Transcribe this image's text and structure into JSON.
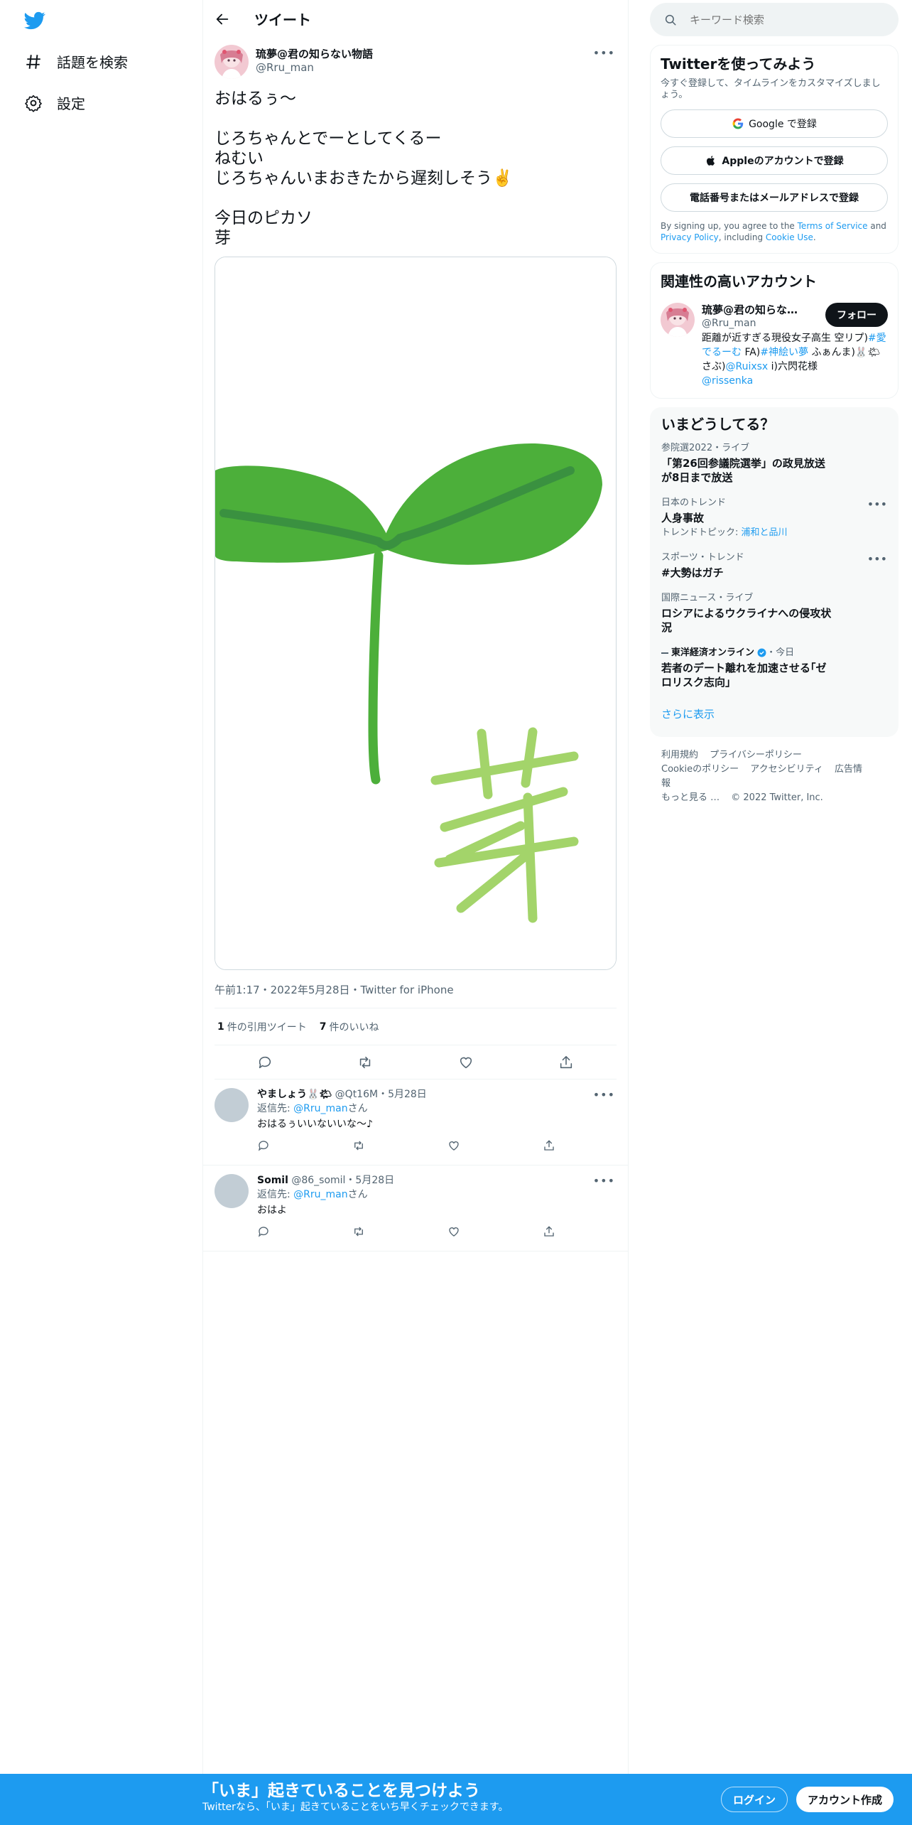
{
  "nav": {
    "explore_label": "話題を検索",
    "settings_label": "設定"
  },
  "header": {
    "title": "ツイート"
  },
  "tweet": {
    "display_name": "琉夢@君の知らない物語",
    "handle": "@Rru_man",
    "text": "おはるぅ〜\n\nじろちゃんとでーとしてくるー\nねむい\nじろちゃんいまおきたから遅刻しそう✌️\n\n今日のピカソ\n芽",
    "image_char": "芽",
    "meta": "午前1:17・2022年5月28日・Twitter for iPhone",
    "quote_count": "1",
    "quote_label": "件の引用ツイート",
    "like_count": "7",
    "like_label": "件のいいね"
  },
  "replies": [
    {
      "name": "やましょう🐰🌤",
      "handle_date": "@Qt16M・5月28日",
      "reply_prefix": "返信先: ",
      "reply_to": "@Rru_man",
      "reply_suffix": "さん",
      "text": "おはるぅいいないいな〜♪"
    },
    {
      "name": "Somil",
      "handle_date": "@86_somil・5月28日",
      "reply_prefix": "返信先: ",
      "reply_to": "@Rru_man",
      "reply_suffix": "さん",
      "text": "おはよ"
    }
  ],
  "search": {
    "placeholder": "キーワード検索"
  },
  "signup": {
    "title": "Twitterを使ってみよう",
    "subtitle": "今すぐ登録して、タイムラインをカスタマイズしましょう。",
    "google_label": "Google で登録",
    "apple_label": "Appleのアカウントで登録",
    "phone_label": "電話番号またはメールアドレスで登録",
    "legal_1": "By signing up, you agree to the ",
    "legal_tos": "Terms of Service",
    "legal_2": " and ",
    "legal_privacy": "Privacy Policy",
    "legal_3": ", including ",
    "legal_cookie": "Cookie Use",
    "legal_4": "."
  },
  "related": {
    "title": "関連性の高いアカウント",
    "name": "琉夢@君の知らない物語",
    "handle": "@Rru_man",
    "follow_label": "フォロー",
    "bio_1": "距離が近すぎる現役女子高生 空リプ)",
    "bio_tag1": "#愛でるーむ",
    "bio_2": " FA)",
    "bio_tag2": "#神絵い夢",
    "bio_3": " ふぁんま)🐰🌤 さぶ)",
    "bio_mention1": "@Ruixsx",
    "bio_4": " i)六閃花様",
    "bio_mention2": "@rissenka"
  },
  "trends": {
    "title": "いまどうしてる？",
    "items": [
      {
        "meta": "参院選2022・ライブ",
        "title": "「第26回参議院選挙」の政見放送が8日まで放送",
        "topic_prefix": "",
        "topic_link": ""
      },
      {
        "meta": "日本のトレンド",
        "title": "人身事故",
        "topic_prefix": "トレンドトピック: ",
        "topic_link": "浦和と品川"
      },
      {
        "meta": "スポーツ・トレンド",
        "title": "#大勢はガチ",
        "topic_prefix": "",
        "topic_link": ""
      },
      {
        "meta": "国際ニュース・ライブ",
        "title": "ロシアによるウクライナへの侵攻状況",
        "topic_prefix": "",
        "topic_link": ""
      },
      {
        "meta_source": "東洋経済オンライン",
        "meta_suffix": "・今日",
        "title": "若者のデート離れを加速させる｢ゼロリスク志向｣"
      }
    ],
    "show_more": "さらに表示"
  },
  "footer": {
    "links": [
      "利用規約",
      "プライバシーポリシー",
      "Cookieのポリシー",
      "アクセシビリティ",
      "広告情報",
      "もっと見る …",
      "© 2022 Twitter, Inc."
    ]
  },
  "bottom_bar": {
    "title": "「いま」起きていることを見つけよう",
    "subtitle": "Twitterなら、「いま」起きていることをいち早くチェックできます。",
    "login_label": "ログイン",
    "signup_label": "アカウント作成"
  },
  "colors": {
    "accent": "#1d9bf0",
    "text": "#0f1419",
    "secondary": "#536471",
    "sprout_leaf": "#4caf3a",
    "sprout_vein": "#3a9140",
    "kanji_green": "#a3d46a"
  }
}
